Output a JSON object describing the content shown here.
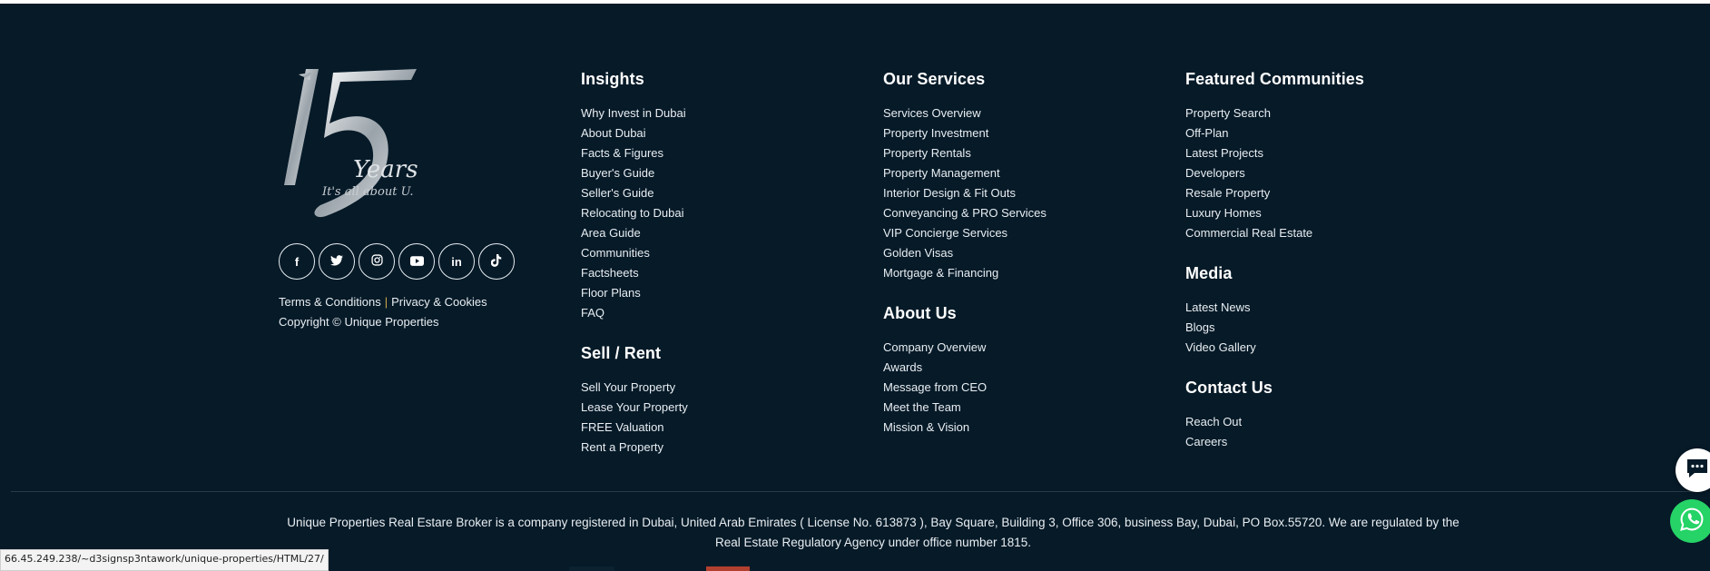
{
  "brand": {
    "logo_number": "15",
    "logo_years": "Years",
    "logo_tagline": "It's all about U."
  },
  "socials": [
    {
      "icon": "facebook-icon",
      "glyph": "f"
    },
    {
      "icon": "twitter-icon",
      "glyph": "🐦"
    },
    {
      "icon": "instagram-icon",
      "glyph": "◎"
    },
    {
      "icon": "youtube-icon",
      "glyph": "▶"
    },
    {
      "icon": "linkedin-icon",
      "glyph": "in"
    },
    {
      "icon": "tiktok-icon",
      "glyph": "♪"
    }
  ],
  "legal": {
    "terms": "Terms & Conditions",
    "separator": "|",
    "privacy": "Privacy & Cookies",
    "copyright": "Copyright © Unique Properties"
  },
  "insights": {
    "title": "Insights",
    "items": [
      "Why Invest in Dubai",
      "About Dubai",
      "Facts & Figures",
      "Buyer's Guide",
      "Seller's Guide",
      "Relocating to Dubai",
      "Area Guide",
      "Communities",
      "Factsheets",
      "Floor Plans",
      "FAQ"
    ]
  },
  "sell_rent": {
    "title": "Sell / Rent",
    "items": [
      "Sell Your Property",
      "Lease Your Property",
      "FREE Valuation",
      "Rent a Property"
    ]
  },
  "services": {
    "title": "Our Services",
    "items": [
      "Services Overview",
      "Property Investment",
      "Property Rentals",
      "Property Management",
      "Interior Design & Fit Outs",
      "Conveyancing & PRO Services",
      "VIP Concierge Services",
      "Golden Visas",
      "Mortgage & Financing"
    ]
  },
  "about": {
    "title": "About Us",
    "items": [
      "Company Overview",
      "Awards",
      "Message from CEO",
      "Meet the Team",
      "Mission & Vision"
    ]
  },
  "communities": {
    "title": "Featured Communities",
    "items": [
      "Property Search",
      "Off-Plan",
      "Latest Projects",
      "Developers",
      "Resale Property",
      "Luxury Homes",
      "Commercial Real Estate"
    ]
  },
  "media": {
    "title": "Media",
    "items": [
      "Latest News",
      "Blogs",
      "Video Gallery"
    ]
  },
  "contact": {
    "title": "Contact Us",
    "items": [
      "Reach Out",
      "Careers"
    ]
  },
  "disclaimer": "Unique Properties Real Estare Broker is a company registered in Dubai, United Arab Emirates ( License No. 613873 ), Bay Square, Building 3, Office 306, business Bay, Dubai, PO Box.55720. We are regulated by the Real Estate Regulatory Agency under office number 1815.",
  "status_url": "66.45.249.238/~d3signsp3ntawork/unique-properties/HTML/27/",
  "colors": {
    "background": "#061a28",
    "text": "#e9eef2",
    "separator_gold": "#c9a94a",
    "whatsapp": "#25d366"
  }
}
